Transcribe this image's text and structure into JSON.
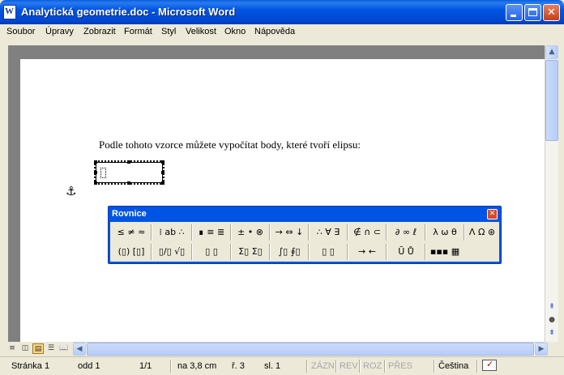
{
  "window": {
    "title": "Analytická geometrie.doc - Microsoft Word",
    "minimize_glyph": "",
    "close_glyph": "✕"
  },
  "menu": {
    "items": [
      {
        "label": "Soubor"
      },
      {
        "label": "Úpravy"
      },
      {
        "label": "Zobrazit"
      },
      {
        "label": "Formát"
      },
      {
        "label": "Styl"
      },
      {
        "label": "Velikost"
      },
      {
        "label": "Okno"
      },
      {
        "label": "Nápověda"
      }
    ]
  },
  "document": {
    "paragraph": "Podle tohoto vzorce můžete vypočítat body, které tvoří elipsu:"
  },
  "equation_toolbar": {
    "title": "Rovnice",
    "close_glyph": "✕",
    "row1": [
      "≤ ≠ ≈",
      "⁞ ab ∴",
      "∎ ≡ ≣",
      "± • ⊗",
      "→ ⇔ ↓",
      "∴ ∀ ∃",
      "∉ ∩ ⊂",
      "∂ ∞ ℓ",
      "λ ω θ",
      "Λ Ω ⊛"
    ],
    "row2": [
      "(▯) [▯]",
      "▯/▯ √▯",
      "▯ ▯",
      "Σ▯ Σ▯",
      "∫▯ ∮▯",
      "▯ ▯",
      "→ ←",
      "Ū Ů",
      "▪▪▪ ▦"
    ]
  },
  "scrollbar": {
    "up_glyph": "▲",
    "down_glyph": "▼",
    "left_glyph": "◀",
    "right_glyph": "▶",
    "prev_glyph": "⇞",
    "select_glyph": "●",
    "next_glyph": "⇟"
  },
  "view_buttons": {
    "normal": "≡",
    "web": "◫",
    "print": "▤",
    "outline": "☰",
    "reading": "📖"
  },
  "status": {
    "page": "Stránka 1",
    "section": "odd 1",
    "pages": "1/1",
    "at": "na 3,8 cm",
    "line": "ř. 3",
    "col": "sl. 1",
    "rec": "ZÁZN",
    "trk": "REV",
    "ext": "ROZ",
    "ovr": "PŘES",
    "language": "Čeština"
  }
}
